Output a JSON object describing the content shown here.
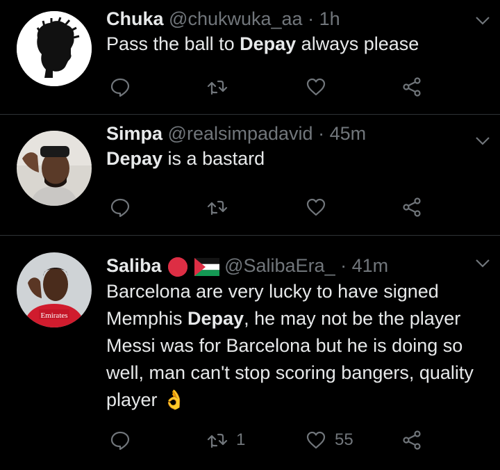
{
  "tweets": [
    {
      "name": "Chuka",
      "handle": "@chukwuka_aa",
      "sep": "·",
      "time": "1h",
      "text_parts": [
        "Pass the ball to ",
        "Depay",
        " always please"
      ],
      "replies": "",
      "retweets": "",
      "likes": ""
    },
    {
      "name": "Simpa",
      "handle": "@realsimpadavid",
      "sep": "·",
      "time": "45m",
      "text_parts": [
        "",
        "Depay",
        " is a bastard"
      ],
      "replies": "",
      "retweets": "",
      "likes": ""
    },
    {
      "name": "Saliba",
      "handle": "@SalibaEra_",
      "sep": "·",
      "time": "41m",
      "text_parts": [
        "Barcelona are very lucky to have signed Memphis ",
        "Depay",
        ", he may not be the player Messi was for Barcelona but he is doing so well, man can't stop scoring bangers, quality player 👌"
      ],
      "replies": "",
      "retweets": "1",
      "likes": "55"
    }
  ],
  "avatar_text": "Emirates",
  "colors": {
    "background": "#000000",
    "text": "#e7e9ea",
    "muted": "#71767b",
    "divider": "#2f3336",
    "red_badge": "#e0245e"
  },
  "icons": [
    "reply-icon",
    "retweet-icon",
    "like-icon",
    "share-icon",
    "caret-down-icon"
  ]
}
